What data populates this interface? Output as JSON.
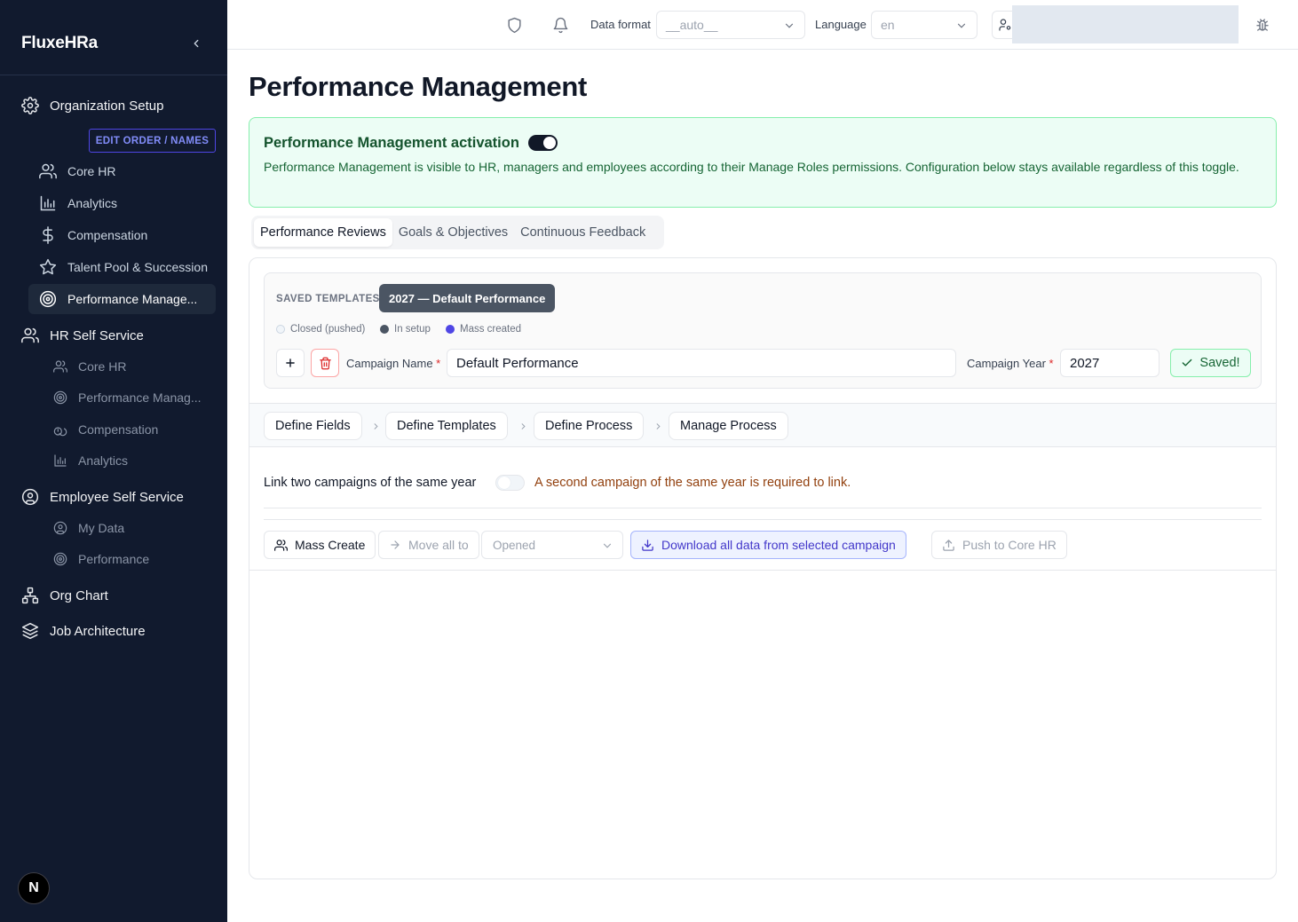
{
  "app": {
    "brand": "FluxeHRa",
    "next_badge": "N"
  },
  "sidebar": {
    "edit_order_label": "EDIT ORDER / NAMES",
    "sections": [
      {
        "label": "Organization Setup",
        "icon": "gear-icon"
      },
      {
        "label": "HR Self Service",
        "icon": "users-icon"
      },
      {
        "label": "Employee Self Service",
        "icon": "user-circle-icon"
      },
      {
        "label": "Org Chart",
        "icon": "org-chart-icon"
      },
      {
        "label": "Job Architecture",
        "icon": "layers-icon"
      }
    ],
    "org_items": [
      {
        "label": "Core HR",
        "icon": "users-icon"
      },
      {
        "label": "Analytics",
        "icon": "bar-chart-icon"
      },
      {
        "label": "Compensation",
        "icon": "dollar-icon"
      },
      {
        "label": "Talent Pool & Succession",
        "icon": "star-icon"
      },
      {
        "label": "Performance Manage...",
        "icon": "target-icon",
        "active": true
      }
    ],
    "hr_items": [
      {
        "label": "Core HR",
        "icon": "users-icon"
      },
      {
        "label": "Performance Manag...",
        "icon": "target-icon"
      },
      {
        "label": "Compensation",
        "icon": "coins-icon"
      },
      {
        "label": "Analytics",
        "icon": "bar-chart-icon"
      }
    ],
    "ess_items": [
      {
        "label": "My Data",
        "icon": "user-circle-icon"
      },
      {
        "label": "Performance",
        "icon": "target-icon"
      }
    ]
  },
  "topbar": {
    "data_format_label": "Data format",
    "data_format_value": "__auto__",
    "language_label": "Language",
    "language_value": "en"
  },
  "page": {
    "title": "Performance Management"
  },
  "activation": {
    "title": "Performance Management activation",
    "enabled": true,
    "description": "Performance Management is visible to HR, managers and employees according to their Manage Roles permissions. Configuration below stays available regardless of this toggle."
  },
  "tabs": [
    {
      "label": "Performance Reviews",
      "active": true
    },
    {
      "label": "Goals & Objectives",
      "active": false
    },
    {
      "label": "Continuous Feedback",
      "active": false
    }
  ],
  "templates": {
    "label": "SAVED TEMPLATES",
    "selected": "2027 — Default Performance",
    "legend": [
      {
        "label": "Closed (pushed)",
        "color": "#f1f5f9"
      },
      {
        "label": "In setup",
        "color": "#4b5563"
      },
      {
        "label": "Mass created",
        "color": "#4f46e5"
      }
    ],
    "campaign_name_label": "Campaign Name",
    "campaign_name_value": "Default Performance",
    "campaign_year_label": "Campaign Year",
    "campaign_year_value": "2027",
    "required_mark": "*",
    "saved_label": "Saved!"
  },
  "steps": [
    "Define Fields",
    "Define Templates",
    "Define Process",
    "Manage Process"
  ],
  "link": {
    "label": "Link two campaigns of the same year",
    "enabled": false,
    "warning": "A second campaign of the same year is required to link."
  },
  "actions": {
    "mass_create": "Mass Create",
    "move_all": "Move all to",
    "status_value": "Opened",
    "download": "Download all data from selected campaign",
    "push": "Push to Core HR"
  },
  "colors": {
    "sidebar_bg": "#111a2e",
    "accent": "#4f46e5",
    "success": "#166534",
    "warning": "#92400e"
  }
}
